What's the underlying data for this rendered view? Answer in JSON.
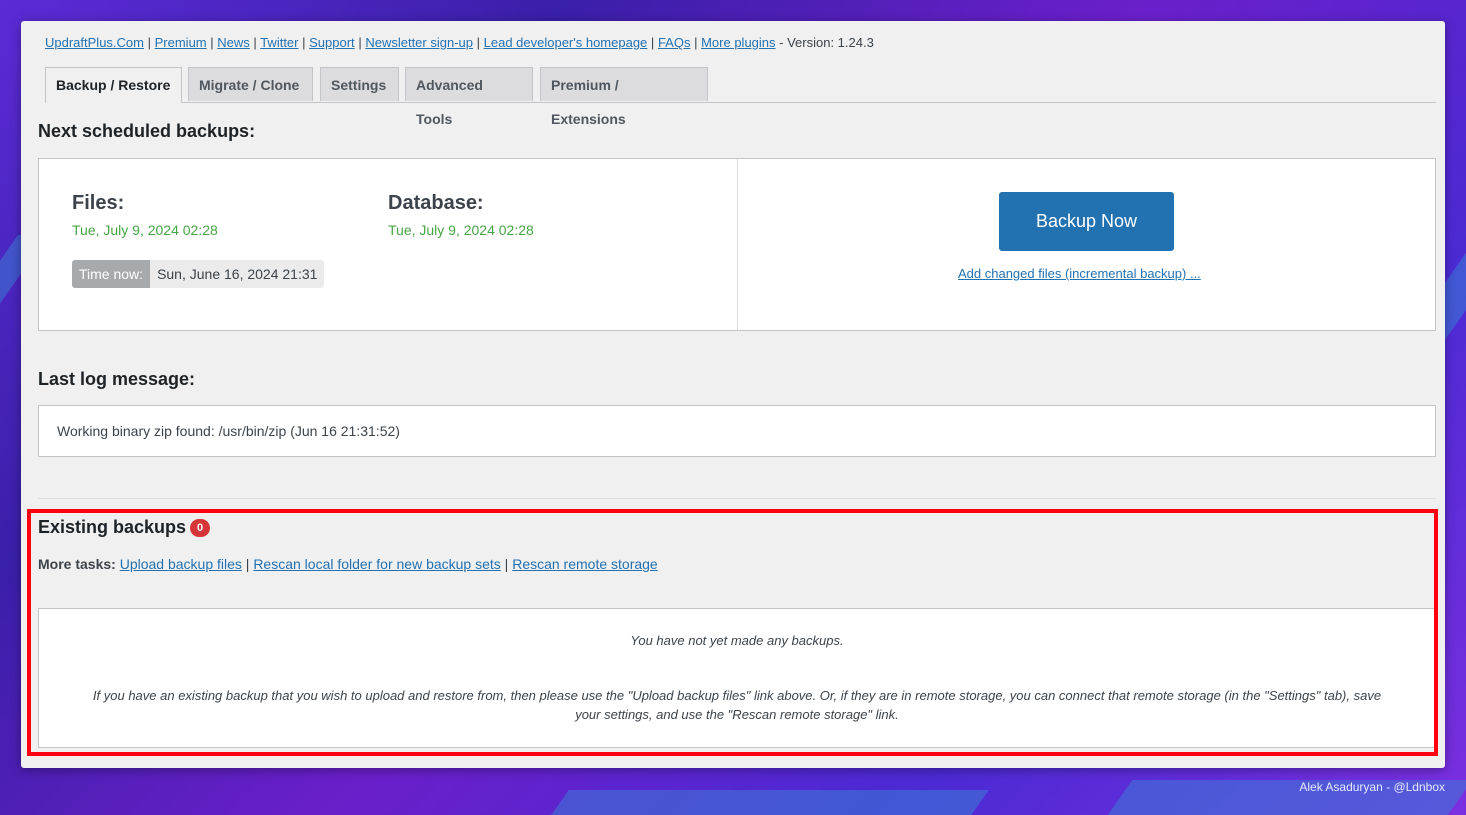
{
  "toplinks": {
    "items": [
      "UpdraftPlus.Com",
      "Premium",
      "News",
      "Twitter",
      "Support",
      "Newsletter sign-up",
      "Lead developer's homepage",
      "FAQs",
      "More plugins"
    ],
    "version": "- Version: 1.24.3"
  },
  "tabs": [
    "Backup / Restore",
    "Migrate / Clone",
    "Settings",
    "Advanced Tools",
    "Premium / Extensions"
  ],
  "scheduled": {
    "heading": "Next scheduled backups:",
    "files_label": "Files:",
    "files_date": "Tue, July 9, 2024 02:28",
    "db_label": "Database:",
    "db_date": "Tue, July 9, 2024 02:28",
    "time_now_label": "Time now:",
    "time_now_value": "Sun, June 16, 2024 21:31",
    "backup_now": "Backup Now",
    "incremental": "Add changed files (incremental backup) ..."
  },
  "log": {
    "heading": "Last log message:",
    "message": "Working binary zip found: /usr/bin/zip (Jun 16 21:31:52)"
  },
  "existing": {
    "heading": "Existing backups",
    "count": "0",
    "more_tasks": "More tasks:",
    "upload": "Upload backup files",
    "rescan_local": "Rescan local folder for new backup sets",
    "rescan_remote": "Rescan remote storage",
    "empty_title": "You have not yet made any backups.",
    "empty_help": "If you have an existing backup that you wish to upload and restore from, then please use the \"Upload backup files\" link above. Or, if they are in remote storage, you can connect that remote storage (in the \"Settings\" tab), save your settings, and use the \"Rescan remote storage\" link."
  },
  "credit": "Alek Asaduryan - @Ldnbox",
  "colors": {
    "accent": "#2271b1",
    "success": "#46a543",
    "badge": "#d63638",
    "highlight": "#ff0010"
  }
}
